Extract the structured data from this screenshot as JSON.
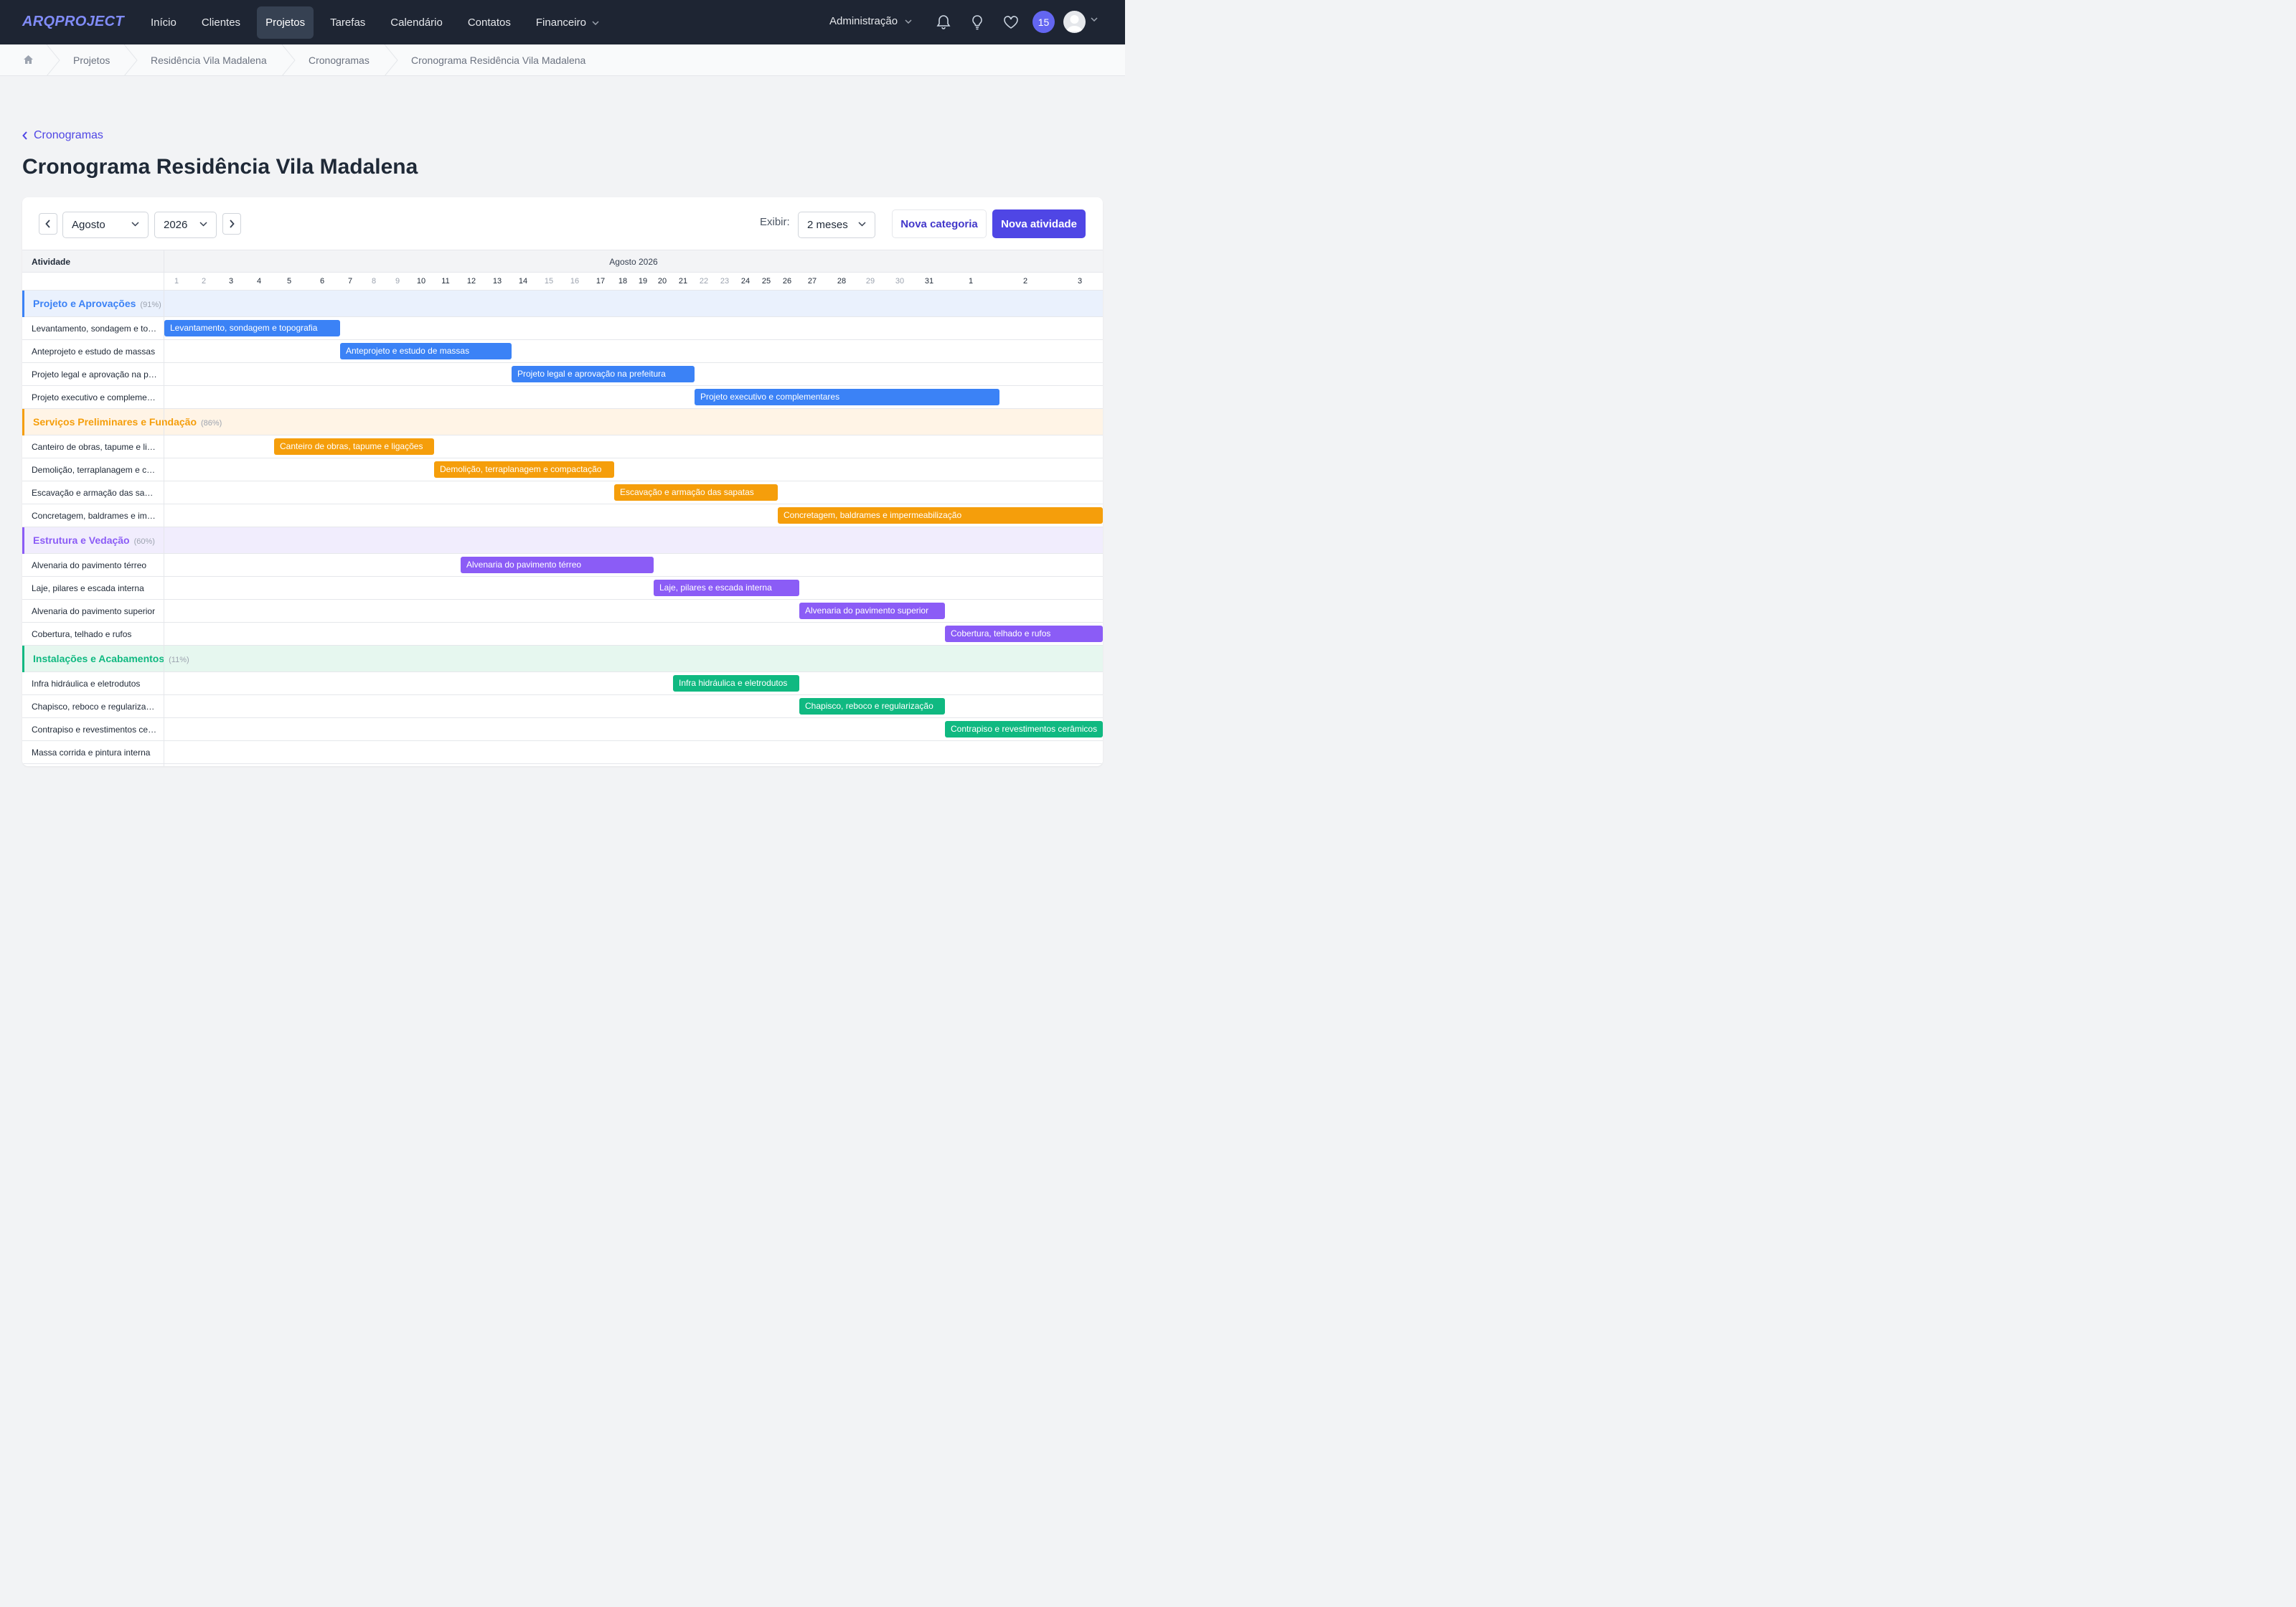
{
  "app": {
    "logo": "ARQPROJECT"
  },
  "nav": {
    "items": [
      "Início",
      "Clientes",
      "Projetos",
      "Tarefas",
      "Calendário",
      "Contatos",
      "Financeiro"
    ],
    "active": "Projetos",
    "admin": "Administração",
    "notifications_badge": "15"
  },
  "breadcrumb": [
    "Projetos",
    "Residência Vila Madalena",
    "Cronogramas",
    "Cronograma Residência Vila Madalena"
  ],
  "page": {
    "back_label": "Cronogramas",
    "title": "Cronograma Residência Vila Madalena"
  },
  "toolbar": {
    "month": "Agosto",
    "year": "2026",
    "exibir_label": "Exibir:",
    "range": "2 meses",
    "new_category": "Nova categoria",
    "new_activity": "Nova atividade"
  },
  "gantt": {
    "activity_header": "Atividade",
    "month_header": "Agosto 2026",
    "days": [
      {
        "d": "1",
        "w": true
      },
      {
        "d": "2",
        "w": true
      },
      {
        "d": "3",
        "w": false
      },
      {
        "d": "4",
        "w": false
      },
      {
        "d": "5",
        "w": false
      },
      {
        "d": "6",
        "w": false
      },
      {
        "d": "7",
        "w": false
      },
      {
        "d": "8",
        "w": true
      },
      {
        "d": "9",
        "w": true
      },
      {
        "d": "10",
        "w": false
      },
      {
        "d": "11",
        "w": false
      },
      {
        "d": "12",
        "w": false
      },
      {
        "d": "13",
        "w": false
      },
      {
        "d": "14",
        "w": false
      },
      {
        "d": "15",
        "w": true
      },
      {
        "d": "16",
        "w": true
      },
      {
        "d": "17",
        "w": false
      },
      {
        "d": "18",
        "w": false
      },
      {
        "d": "19",
        "w": false
      },
      {
        "d": "20",
        "w": false
      },
      {
        "d": "21",
        "w": false
      },
      {
        "d": "22",
        "w": true
      },
      {
        "d": "23",
        "w": true
      },
      {
        "d": "24",
        "w": false
      },
      {
        "d": "25",
        "w": false
      },
      {
        "d": "26",
        "w": false
      },
      {
        "d": "27",
        "w": false
      },
      {
        "d": "28",
        "w": false
      },
      {
        "d": "29",
        "w": true
      },
      {
        "d": "30",
        "w": true
      },
      {
        "d": "31",
        "w": false
      },
      {
        "d": "1",
        "w": false
      },
      {
        "d": "2",
        "w": false
      },
      {
        "d": "3",
        "w": false
      }
    ],
    "categories": [
      {
        "name": "Projeto e Aprovações",
        "pct": "(91%)",
        "color": "#3b82f6",
        "bg": "#eaf1fd",
        "activities": [
          {
            "name": "Levantamento, sondagem e topografia",
            "label": "Levantamento, sondagem e topografia"
          },
          {
            "name": "Anteprojeto e estudo de massas",
            "label": "Anteprojeto e estudo de massas"
          },
          {
            "name": "Projeto legal e aprovação na prefeitura",
            "label": "Projeto legal e aprovação na prefeitura"
          },
          {
            "name": "Projeto executivo e complementares",
            "label": "Projeto executivo e complementares"
          }
        ]
      },
      {
        "name": "Serviços Preliminares e Fundação",
        "pct": "(86%)",
        "color": "#f59e0b",
        "bg": "#fff4e6",
        "activities": [
          {
            "name": "Canteiro de obras, tapume e ligações",
            "label": "Canteiro de obras, tapume e ligações"
          },
          {
            "name": "Demolição, terraplanagem e compactação",
            "label": "Demolição, terraplanagem e compactação"
          },
          {
            "name": "Escavação e armação das sapatas",
            "label": "Escavação e armação das sapatas"
          },
          {
            "name": "Concretagem, baldrames e impermeabilização",
            "label": "Concretagem, baldrames e impermeabilização"
          }
        ]
      },
      {
        "name": "Estrutura e Vedação",
        "pct": "(60%)",
        "color": "#8b5cf6",
        "bg": "#f1edfd",
        "activities": [
          {
            "name": "Alvenaria do pavimento térreo",
            "label": "Alvenaria do pavimento térreo"
          },
          {
            "name": "Laje, pilares e escada interna",
            "label": "Laje, pilares e escada interna"
          },
          {
            "name": "Alvenaria do pavimento superior",
            "label": "Alvenaria do pavimento superior"
          },
          {
            "name": "Cobertura, telhado e rufos",
            "label": "Cobertura, telhado e rufos"
          }
        ]
      },
      {
        "name": "Instalações e Acabamentos",
        "pct": "(11%)",
        "color": "#10b981",
        "bg": "#e6f7ef",
        "activities": [
          {
            "name": "Infra hidráulica e eletrodutos",
            "label": "Infra hidráulica e eletrodutos"
          },
          {
            "name": "Chapisco, reboco e regularização",
            "label": "Chapisco, reboco e regularização"
          },
          {
            "name": "Contrapiso e revestimentos cerâmicos",
            "label": "Contrapiso e revestimentos cerâmicos"
          },
          {
            "name": "Massa corrida e pintura interna",
            "label": ""
          }
        ]
      }
    ]
  }
}
